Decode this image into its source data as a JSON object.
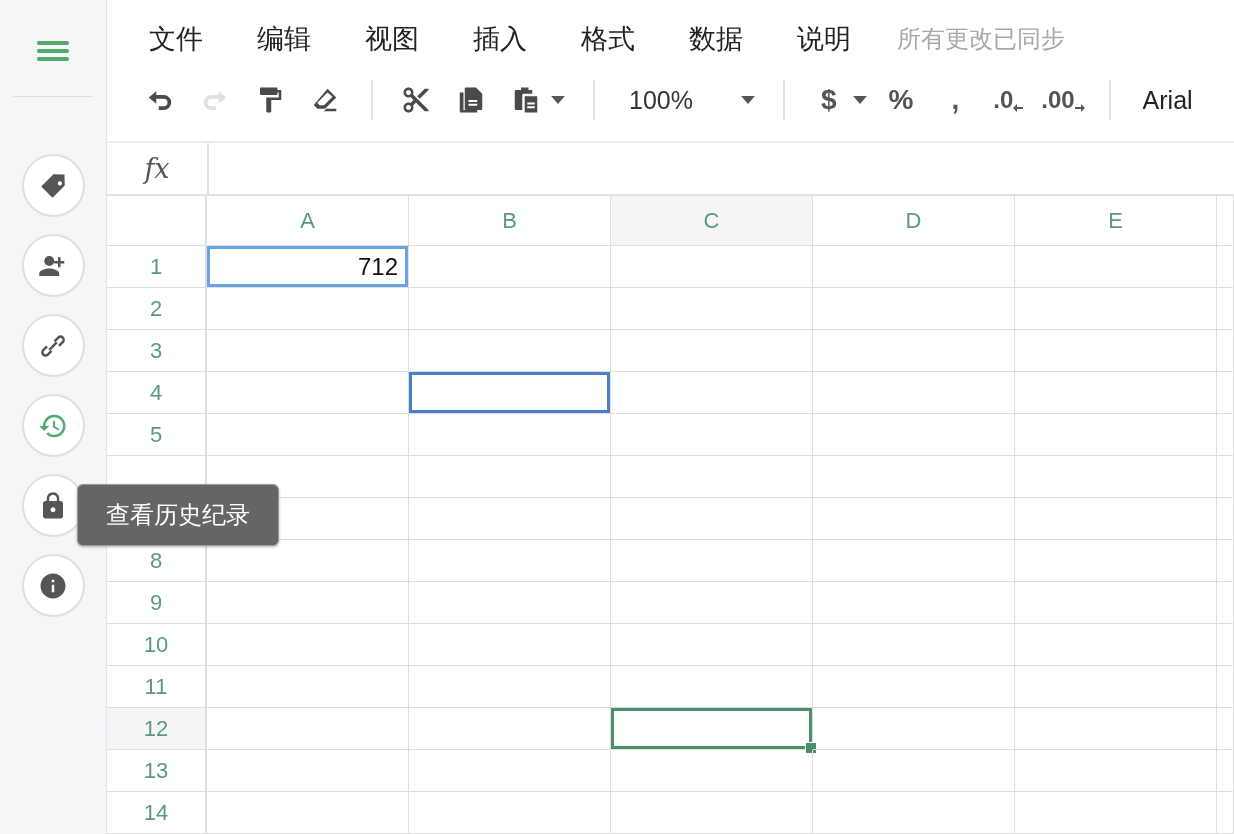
{
  "sidebar": {
    "buttons": [
      {
        "selected": false
      },
      {
        "selected": false
      },
      {
        "selected": false
      },
      {
        "selected": true
      },
      {
        "selected": false
      },
      {
        "selected": false
      }
    ],
    "tooltip": "查看历史纪录"
  },
  "menu": {
    "items": [
      "文件",
      "编辑",
      "视图",
      "插入",
      "格式",
      "数据",
      "说明"
    ],
    "status": "所有更改已同步"
  },
  "toolbar": {
    "undo": {
      "disabled": false
    },
    "redo": {
      "disabled": true
    },
    "zoom": "100%",
    "currency": "$",
    "percent": "%",
    "comma": ",",
    "decrease_decimals": ".0",
    "increase_decimals": ".00",
    "font": "Arial"
  },
  "formula_bar": {
    "label": "fx"
  },
  "columns": [
    {
      "label": "A"
    },
    {
      "label": "B"
    },
    {
      "label": "C"
    },
    {
      "label": "D"
    },
    {
      "label": "E"
    }
  ],
  "rows": [
    {
      "label": "1",
      "cells": [
        {
          "value": "712",
          "selected": false,
          "color": "#6aa2e8"
        },
        {
          "selected": false
        },
        {
          "selected": false
        },
        {
          "selected": false
        },
        {
          "selected": false
        }
      ]
    },
    {
      "label": "2",
      "cells": [
        {
          "selected": false
        },
        {
          "selected": false
        },
        {
          "selected": false
        },
        {
          "selected": false
        },
        {
          "selected": false
        }
      ]
    },
    {
      "label": "3",
      "cells": [
        {
          "selected": false
        },
        {
          "selected": false
        },
        {
          "selected": false
        },
        {
          "selected": false
        },
        {
          "selected": false
        }
      ]
    },
    {
      "label": "4",
      "cells": [
        {
          "selected": false
        },
        {
          "selected": false,
          "color": "#4a7fc8"
        },
        {
          "selected": false
        },
        {
          "selected": false
        },
        {
          "selected": false
        }
      ]
    },
    {
      "label": "5",
      "cells": [
        {
          "selected": false
        },
        {
          "selected": false
        },
        {
          "selected": false
        },
        {
          "selected": false
        },
        {
          "selected": false
        }
      ]
    },
    {
      "cells": [
        {
          "selected": false
        },
        {
          "selected": false
        },
        {
          "selected": false
        },
        {
          "selected": false
        },
        {
          "selected": false
        }
      ]
    },
    {
      "cells": [
        {
          "selected": false
        },
        {
          "selected": false
        },
        {
          "selected": false
        },
        {
          "selected": false
        },
        {
          "selected": false
        }
      ]
    },
    {
      "label": "8",
      "cells": [
        {
          "selected": false
        },
        {
          "selected": false
        },
        {
          "selected": false
        },
        {
          "selected": false
        },
        {
          "selected": false
        }
      ]
    },
    {
      "label": "9",
      "cells": [
        {
          "selected": false
        },
        {
          "selected": false
        },
        {
          "selected": false
        },
        {
          "selected": false
        },
        {
          "selected": false
        }
      ]
    },
    {
      "label": "10",
      "cells": [
        {
          "selected": false
        },
        {
          "selected": false
        },
        {
          "selected": false
        },
        {
          "selected": false
        },
        {
          "selected": false
        }
      ]
    },
    {
      "label": "11",
      "cells": [
        {
          "selected": false
        },
        {
          "selected": false
        },
        {
          "selected": false
        },
        {
          "selected": false
        },
        {
          "selected": false
        }
      ]
    },
    {
      "label": "12",
      "cells": [
        {
          "selected": false
        },
        {
          "selected": false
        },
        {
          "selected": true
        },
        {
          "selected": false
        },
        {
          "selected": false
        }
      ]
    },
    {
      "label": "13",
      "cells": [
        {
          "selected": false
        },
        {
          "selected": false
        },
        {
          "selected": false
        },
        {
          "selected": false
        },
        {
          "selected": false
        }
      ]
    },
    {
      "label": "14",
      "cells": [
        {
          "selected": false
        },
        {
          "selected": false
        },
        {
          "selected": false
        },
        {
          "selected": false
        },
        {
          "selected": false
        }
      ]
    }
  ]
}
